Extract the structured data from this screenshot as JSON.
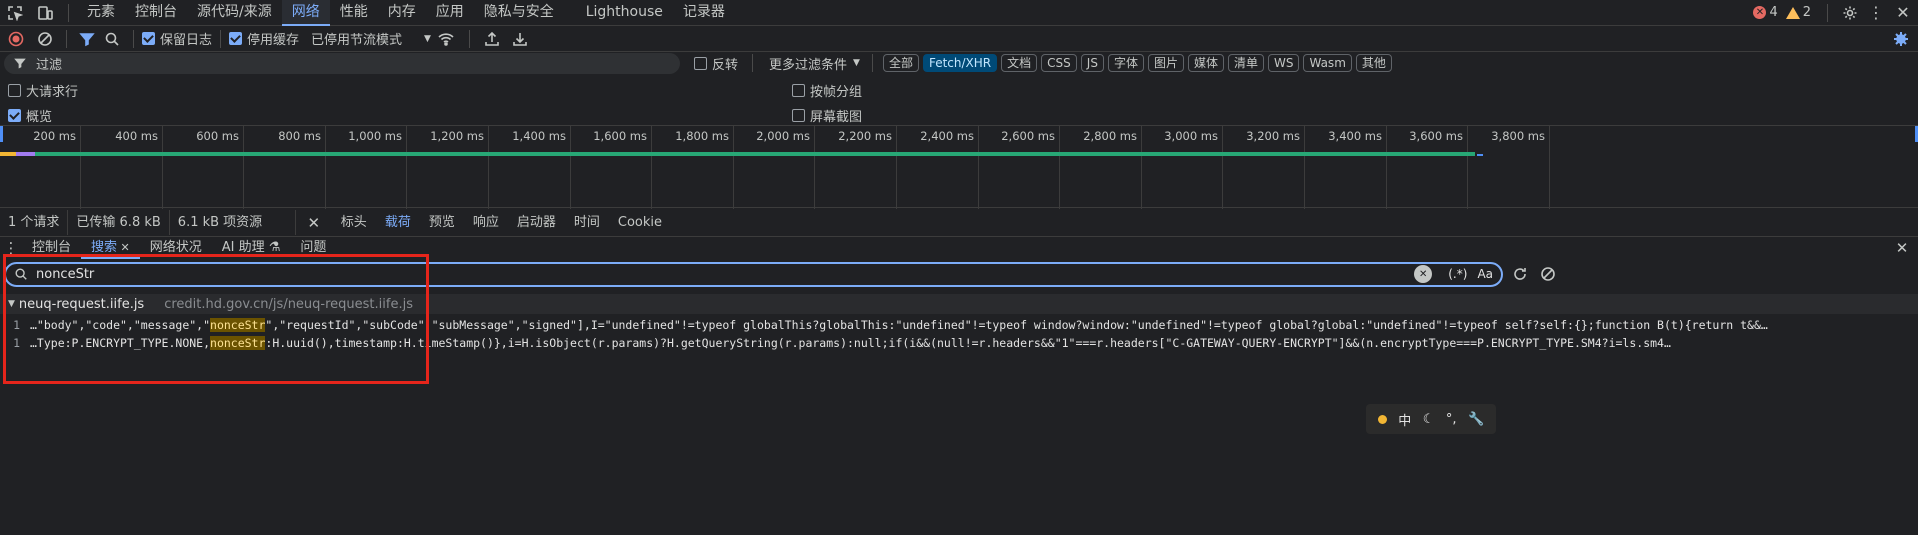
{
  "tabs": [
    "元素",
    "控制台",
    "源代码/来源",
    "网络",
    "性能",
    "内存",
    "应用",
    "隐私与安全",
    "Lighthouse",
    "记录器"
  ],
  "active_tab_index": 3,
  "badges": {
    "errors": "4",
    "warnings": "2"
  },
  "toolbar": {
    "preserve_log": "保留日志",
    "disable_cache": "停用缓存",
    "throttle": "已停用节流模式"
  },
  "filter": {
    "placeholder": "过滤",
    "invert": "反转",
    "more_filters": "更多过滤条件",
    "types": [
      "全部",
      "Fetch/XHR",
      "文档",
      "CSS",
      "JS",
      "字体",
      "图片",
      "媒体",
      "清单",
      "WS",
      "Wasm",
      "其他"
    ],
    "active_type_index": 1
  },
  "options": {
    "big_rows": "大请求行",
    "overview": "概览",
    "group_by_frame": "按帧分组",
    "screenshots": "屏幕截图"
  },
  "timeline": {
    "ticks": [
      "200 ms",
      "400 ms",
      "600 ms",
      "800 ms",
      "1,000 ms",
      "1,200 ms",
      "1,400 ms",
      "1,600 ms",
      "1,800 ms",
      "2,000 ms",
      "2,200 ms",
      "2,400 ms",
      "2,600 ms",
      "2,800 ms",
      "3,000 ms",
      "3,200 ms",
      "3,400 ms",
      "3,600 ms",
      "3,800 ms"
    ],
    "colors": {
      "bar": "#27a775",
      "waiting": "#f2b634",
      "purple": "#a17bf0",
      "blue": "#4f8ff6"
    }
  },
  "summary": {
    "requests": "1 个请求",
    "transferred": "已传输 6.8 kB",
    "resources": "6.1 kB 项资源"
  },
  "detail_tabs": [
    "标头",
    "载荷",
    "预览",
    "响应",
    "启动器",
    "时间",
    "Cookie"
  ],
  "detail_active_index": 1,
  "drawer_tabs": [
    "控制台",
    "搜索",
    "网络状况",
    "AI 助理 ⚗",
    "问题"
  ],
  "drawer_active_index": 1,
  "search": {
    "value": "nonceStr",
    "regex_label": "(.*)",
    "case_label": "Aa"
  },
  "results": {
    "file": "neuq-request.iife.js",
    "url": "credit.hd.gov.cn/js/neuq-request.iife.js",
    "lines": [
      {
        "num": "1",
        "before": "…\"body\",\"code\",\"message\",\"",
        "match": "nonceStr",
        "after": "\",\"requestId\",\"subCode\",\"subMessage\",\"signed\"],I=\"undefined\"!=typeof globalThis?globalThis:\"undefined\"!=typeof window?window:\"undefined\"!=typeof global?global:\"undefined\"!=typeof self?self:{};function B(t){return t&&…"
      },
      {
        "num": "1",
        "before": "…Type:P.ENCRYPT_TYPE.NONE,",
        "match": "nonceStr",
        "after": ":H.uuid(),timestamp:H.timeStamp()},i=H.isObject(r.params)?H.getQueryString(r.params):null;if(i&&(null!=r.headers&&\"1\"===r.headers[\"C-GATEWAY-QUERY-ENCRYPT\"]&&(n.encryptType===P.ENCRYPT_TYPE.SM4?i=ls.sm4…"
      }
    ]
  },
  "ime": {
    "lang": "中"
  }
}
